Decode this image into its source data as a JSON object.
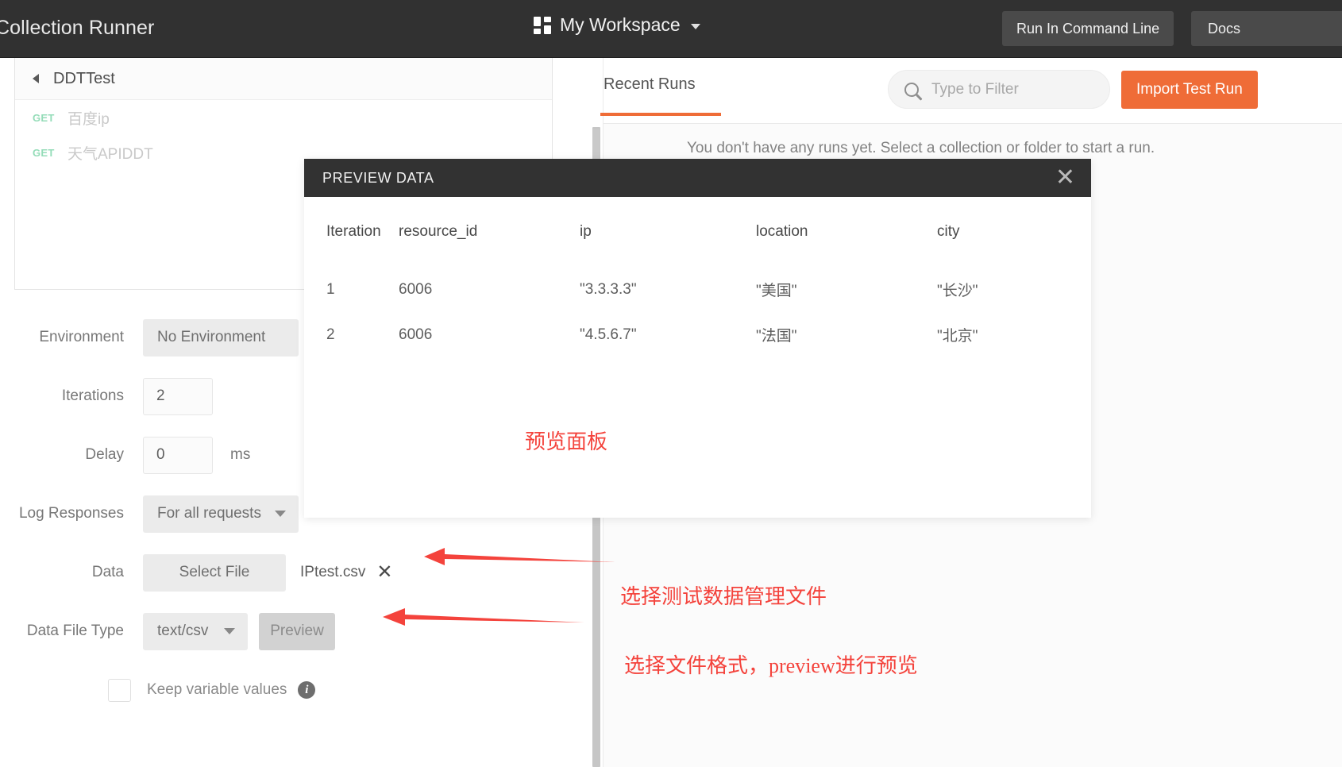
{
  "topbar": {
    "title": "Collection Runner",
    "workspace_label": "My Workspace",
    "run_in_cmd_label": "Run In Command Line",
    "docs_label": "Docs"
  },
  "left_panel": {
    "collection": {
      "name": "DDTTest",
      "requests": [
        {
          "method": "GET",
          "name": "百度ip"
        },
        {
          "method": "GET",
          "name": "天气APIDDT"
        }
      ]
    },
    "form": {
      "environment_label": "Environment",
      "environment_value": "No Environment",
      "iterations_label": "Iterations",
      "iterations_value": "2",
      "delay_label": "Delay",
      "delay_value": "0",
      "delay_unit": "ms",
      "log_responses_label": "Log Responses",
      "log_responses_value": "For all requests",
      "data_label": "Data",
      "select_file_label": "Select File",
      "data_file_name": "IPtest.csv",
      "clear_file_icon": "✕",
      "data_file_type_label": "Data File Type",
      "data_file_type_value": "text/csv",
      "preview_label": "Preview",
      "keep_variable_values_label": "Keep variable values"
    }
  },
  "right_panel": {
    "tab_label": "Recent Runs",
    "filter_placeholder": "Type to Filter",
    "filter_value": "",
    "import_label": "Import Test Run",
    "empty_message": "You don't have any runs yet. Select a collection or folder to start a run."
  },
  "modal": {
    "title": "PREVIEW DATA",
    "close_icon": "✕",
    "columns": [
      "Iteration",
      "resource_id",
      "ip",
      "location",
      "city"
    ],
    "rows": [
      [
        "1",
        "6006",
        "\"3.3.3.3\"",
        "\"美国\"",
        "\"长沙\""
      ],
      [
        "2",
        "6006",
        "\"4.5.6.7\"",
        "\"法国\"",
        "\"北京\""
      ]
    ]
  },
  "annotations": {
    "preview_panel": "预览面板",
    "select_data_file": "选择测试数据管理文件",
    "select_format": "选择文件格式，preview进行预览"
  },
  "colors": {
    "accent": "#ef6c37",
    "topbar_bg": "#313131",
    "modal_header_bg": "#323232",
    "annotation_red": "#f4433c",
    "method_get": "#94dcb8"
  }
}
